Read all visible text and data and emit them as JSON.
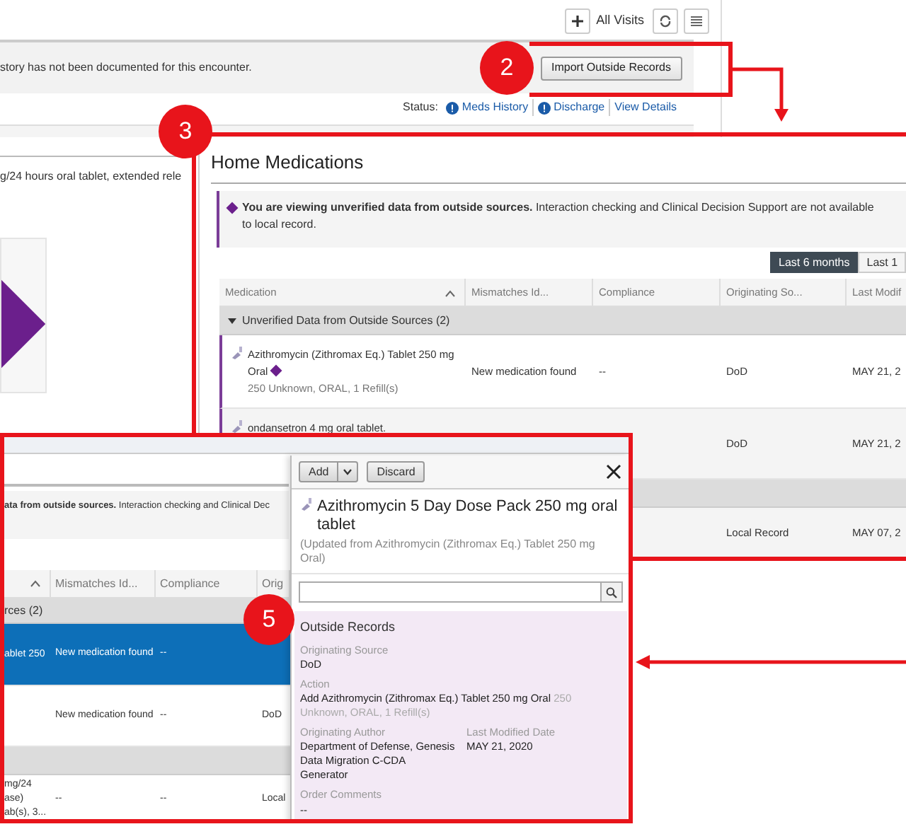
{
  "callouts": [
    {
      "label": "2"
    },
    {
      "label": "3"
    },
    {
      "label": "5"
    }
  ],
  "visit_toolbar": {
    "label": "All Visits"
  },
  "banner": {
    "message": "story has not been documented for this encounter.",
    "button": "Import Outside Records"
  },
  "status": {
    "label": "Status:",
    "items": [
      {
        "label": "Meds History",
        "kind": "alert"
      },
      {
        "label": "Discharge",
        "kind": "alert"
      },
      {
        "label": "View Details",
        "kind": "link"
      }
    ]
  },
  "background_order": {
    "text": "g/24 hours oral tablet, extended rele"
  },
  "home_medications": {
    "title": "Home Medications",
    "alert_lines": [
      "**You are viewing unverified data from outside sources.** Interaction checking and Clinical Decision Support are not available",
      "to local record."
    ],
    "ranges": [
      {
        "label": "Last 6 months",
        "selected": true
      },
      {
        "label": "Last 1",
        "selected": false
      }
    ],
    "columns": [
      "Medication",
      "Mismatches Id...",
      "Compliance",
      "Originating So...",
      "Last Modif"
    ],
    "rows": [
      {
        "kind": "group",
        "expanded": true,
        "label": "Unverified Data from Outside Sources (2)"
      },
      {
        "kind": "medication",
        "unverified": true,
        "name": "Azithromycin (Zithromax Eq.) Tablet 250 mg Oral",
        "detail": "250 Unknown, ORAL, 1 Refill(s)",
        "mismatch": "New medication found",
        "compliance": "--",
        "source": "DoD",
        "modified": "MAY 21, 2"
      },
      {
        "kind": "medication",
        "unverified": true,
        "name": "ondansetron 4 mg oral tablet.",
        "source": "DoD",
        "modified": "MAY 21, 2"
      },
      {
        "kind": "group"
      },
      {
        "kind": "medication",
        "source": "Local Record",
        "modified": "MAY 07, 2"
      }
    ]
  },
  "order_view": {
    "alert": "**ata from outside sources.** Interaction checking and Clinical Dec",
    "columns": [
      "Mismatches Id...",
      "Compliance",
      "Orig"
    ],
    "rows": [
      {
        "kind": "group",
        "label": "rces (2)"
      },
      {
        "kind": "medication",
        "selected": true,
        "name_lines": [
          "ablet 250"
        ],
        "mismatch": "New medication found",
        "compliance": "--"
      },
      {
        "kind": "medication",
        "selected": false,
        "mismatch": "New medication found",
        "compliance": "--",
        "source": "DoD"
      },
      {
        "kind": "group"
      },
      {
        "kind": "medication",
        "selected": false,
        "name_lines": [
          "mg/24",
          "ase)",
          "ab(s), 3..."
        ],
        "mismatch": "--",
        "compliance": "--",
        "source": "Local"
      }
    ]
  },
  "detail": {
    "buttons": [
      "Add",
      "Discard"
    ],
    "title": "Azithromycin 5 Day Dose Pack 250 mg oral tablet",
    "subtitle": "(Updated from Azithromycin (Zithromax Eq.) Tablet 250 mg Oral)",
    "section": "Outside Records",
    "fields": [
      {
        "kind": "full",
        "label": "Originating Source",
        "value": "DoD"
      },
      {
        "kind": "full",
        "label": "Action",
        "value": "Add Azithromycin (Zithromax Eq.) Tablet 250 mg Oral",
        "note": "250 Unknown, ORAL, 1 Refill(s)"
      },
      {
        "kind": "half",
        "label": "Originating Author",
        "value": "Department of Defense, Genesis Data Migration C-CDA Generator"
      },
      {
        "kind": "half",
        "label": "Last Modified Date",
        "value": "MAY 21, 2020"
      },
      {
        "kind": "full",
        "label": "Order Comments",
        "value": "--"
      }
    ]
  }
}
